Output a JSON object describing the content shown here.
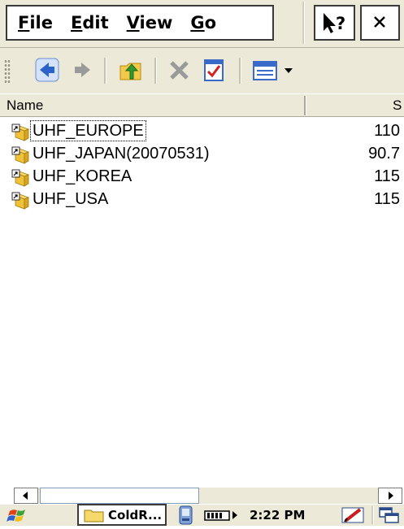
{
  "menubar": {
    "items": [
      {
        "label_accel": "F",
        "label_rest": "ile"
      },
      {
        "label_accel": "E",
        "label_rest": "dit"
      },
      {
        "label_accel": "V",
        "label_rest": "iew"
      },
      {
        "label_accel": "G",
        "label_rest": "o"
      }
    ],
    "help_icon": "question-arrow-icon",
    "close_label": "×"
  },
  "toolbar": {
    "buttons": [
      "back-icon",
      "forward-icon",
      "folder-up-icon",
      "delete-icon",
      "properties-icon",
      "view-menu-icon"
    ]
  },
  "list": {
    "columns": {
      "name": "Name",
      "size": "S"
    },
    "rows": [
      {
        "name": "UHF_EUROPE",
        "size": "110",
        "icon": "shortcut-folder-icon"
      },
      {
        "name": "UHF_JAPAN(20070531)",
        "size": "90.7",
        "icon": "shortcut-folder-icon"
      },
      {
        "name": "UHF_KOREA",
        "size": "115",
        "icon": "shortcut-folder-icon"
      },
      {
        "name": "UHF_USA",
        "size": "115",
        "icon": "shortcut-folder-icon"
      }
    ]
  },
  "taskbar": {
    "task_label": "ColdR...",
    "time": "2:22 PM"
  },
  "colors": {
    "chrome": "#ece9d8",
    "selection_blue": "#3169c6"
  }
}
